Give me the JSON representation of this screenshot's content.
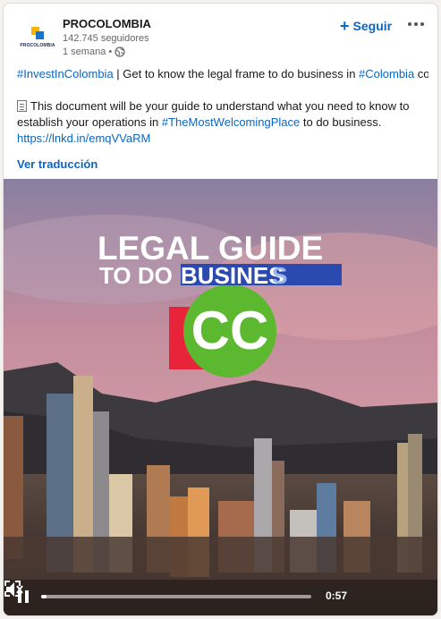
{
  "post": {
    "company": "PROCOLOMBIA",
    "logo_text": "PROCOLOMBIA",
    "followers": "142.745 seguidores",
    "time": "1 semana •",
    "follow_label": "Seguir",
    "line1_tag1": "#InvestInColombia",
    "line1_text": " | Get to know the legal frame to do business in ",
    "line1_tag2": "#Colombia",
    "line1_tail": " co",
    "line3_text": "This document will be your guide to understand what you need to know to",
    "line4_text": "establish your operations in ",
    "line4_tag": "#TheMostWelcomingPlace",
    "line4_tail": " to do business.",
    "link": "https://lnkd.in/emqVVaRM",
    "translate_label": "Ver traducción"
  },
  "video": {
    "title_line1": "LEGAL GUIDE",
    "title_line2_prefix": "TO DO ",
    "title_line2_highlight": "BUSINES",
    "title_line2_tail": "S",
    "emblem_text": "CC",
    "time": "0:57",
    "progress_fraction": 0.02
  },
  "icons": {
    "follow": "plus-icon",
    "more": "more-options-icon",
    "visibility": "globe-icon",
    "doc": "document-icon",
    "pause": "pause-icon",
    "mute": "muted-speaker-icon",
    "fullscreen": "fullscreen-icon"
  },
  "colors": {
    "link": "#0a66c2",
    "title_blue": "#2b4ab0",
    "emblem_green": "#5cb82e",
    "emblem_red": "#e8243a"
  }
}
